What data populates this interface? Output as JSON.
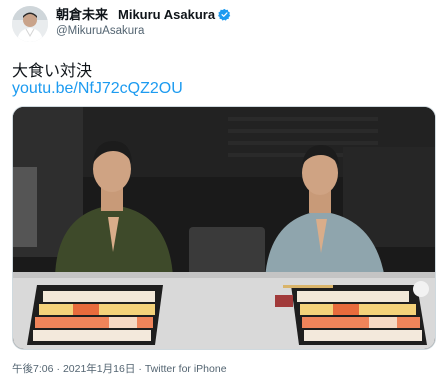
{
  "author": {
    "display_name_jp": "朝倉未来",
    "display_name_latin": "Mikuru Asakura",
    "handle": "@MikuruAsakura",
    "verified_icon": "verified-badge-icon"
  },
  "tweet": {
    "text": "大食い対決",
    "link_text": "youtu.be/NfJ72cQZ2OU"
  },
  "media": {
    "type": "video-thumbnail"
  },
  "meta": {
    "time": "午後7:06",
    "separator": "·",
    "date": "2021年1月16日",
    "source": "Twitter for iPhone"
  },
  "colors": {
    "link": "#1d9bf0",
    "secondary_text": "#536471",
    "verified": "#1d9bf0"
  }
}
